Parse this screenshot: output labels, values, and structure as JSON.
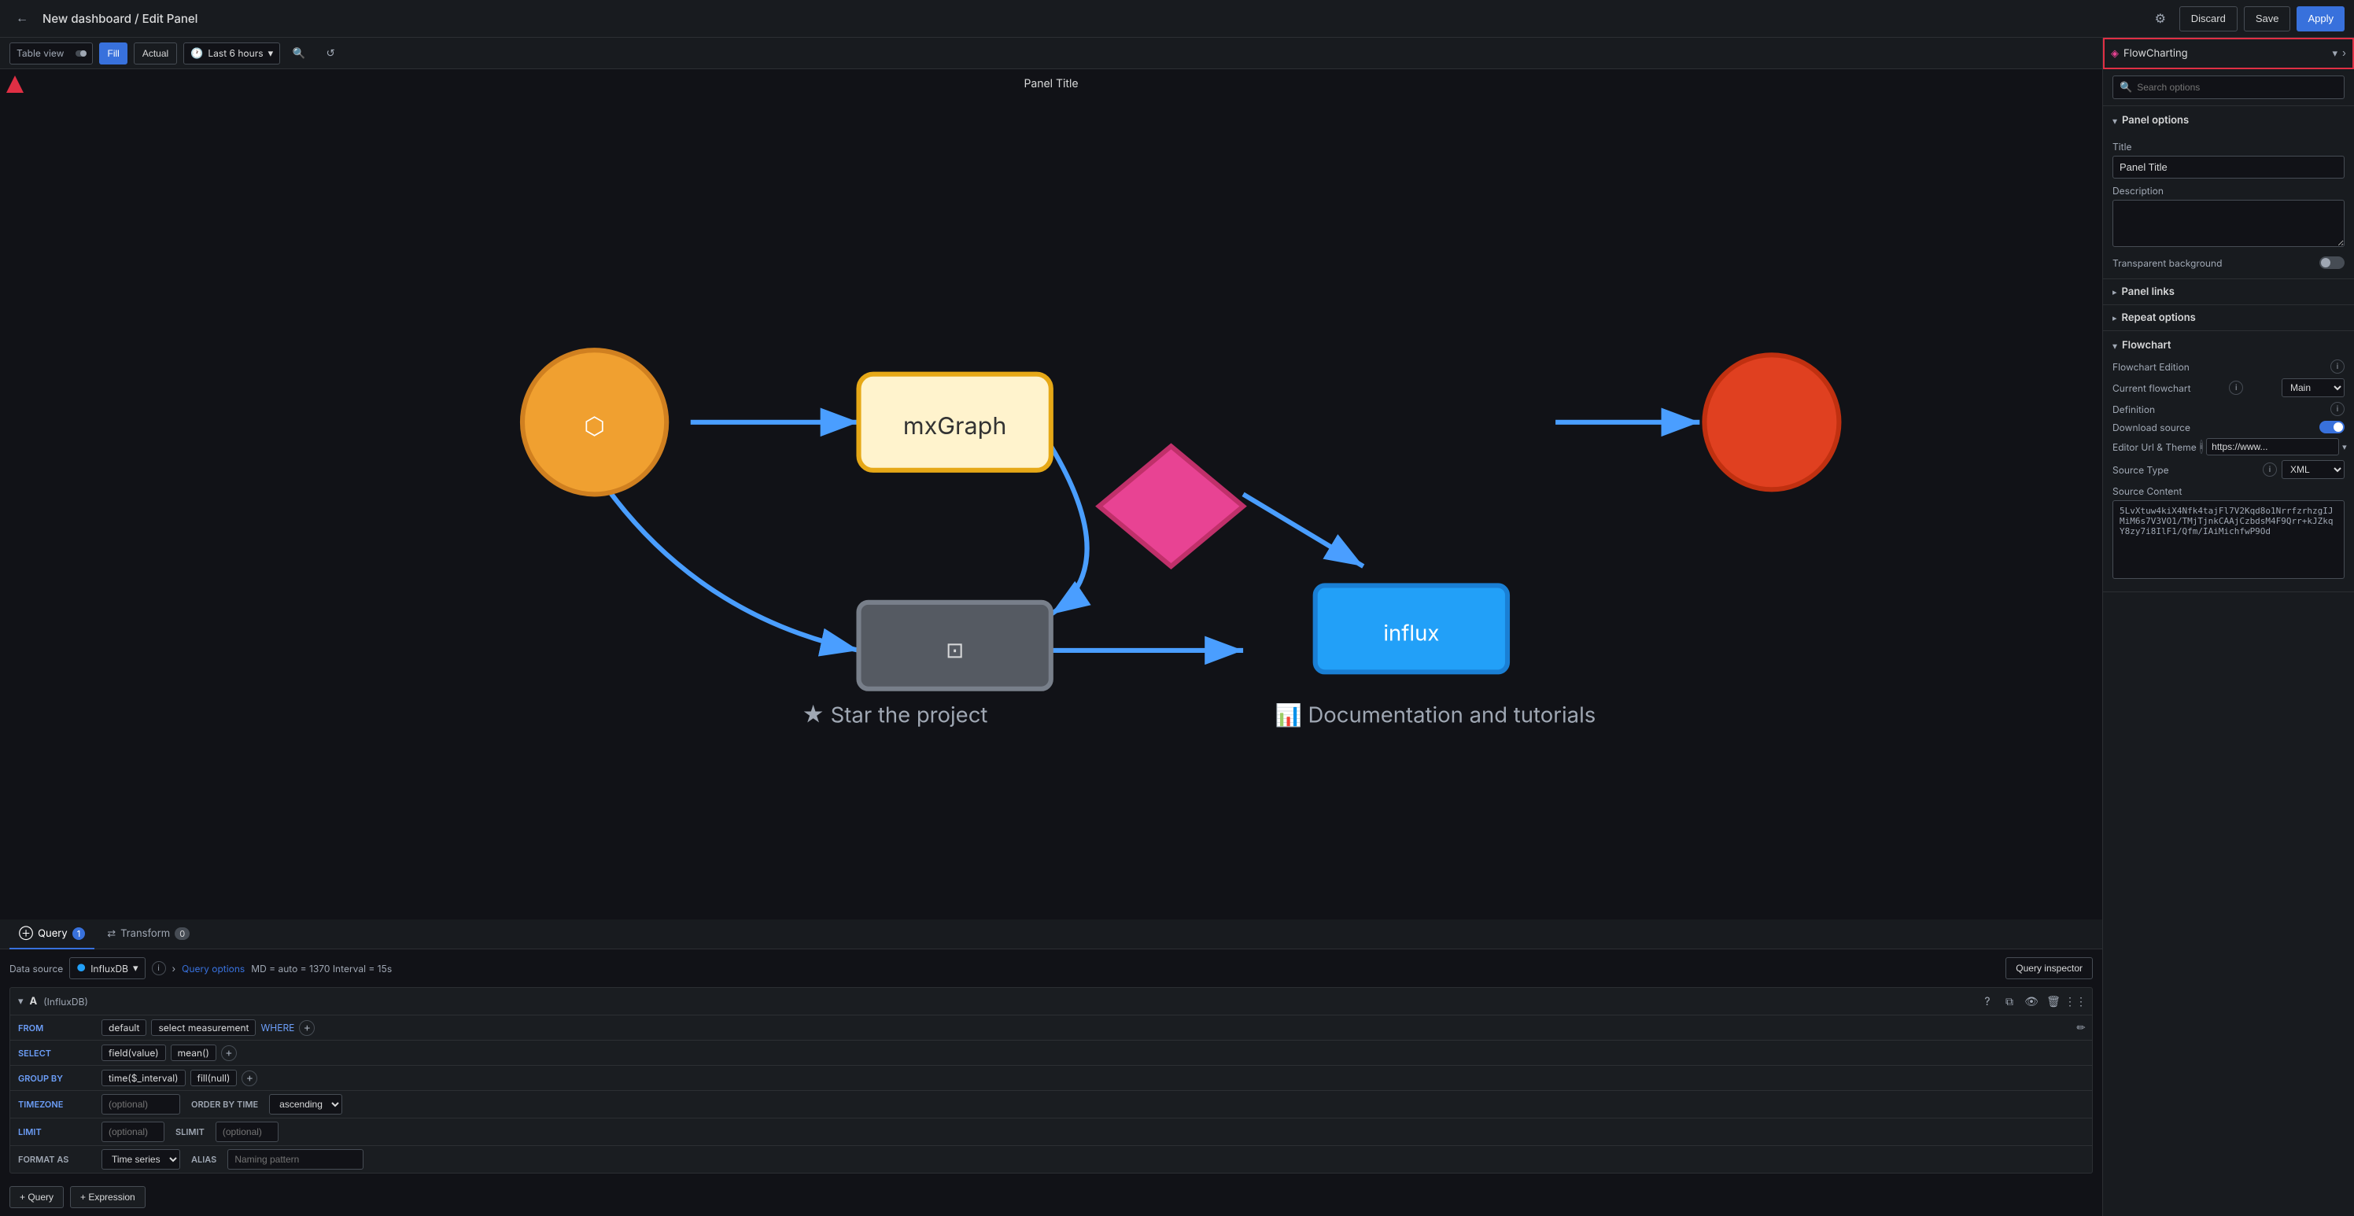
{
  "topbar": {
    "back_arrow": "←",
    "title": "New dashboard / Edit Panel",
    "gear_icon": "⚙",
    "discard_label": "Discard",
    "save_label": "Save",
    "apply_label": "Apply"
  },
  "panel_toolbar": {
    "table_view_label": "Table view",
    "fill_label": "Fill",
    "actual_label": "Actual",
    "time_label": "Last 6 hours",
    "panel_selector": "FlowCharting",
    "zoom_icon": "🔍",
    "refresh_icon": "↺"
  },
  "panel": {
    "title": "Panel Title",
    "alert_color": "#e02f44"
  },
  "query_tabs": [
    {
      "label": "Query",
      "badge": "1",
      "icon": "⊕"
    },
    {
      "label": "Transform",
      "badge": "0",
      "icon": "⇄"
    }
  ],
  "query_editor": {
    "datasource_label": "Data source",
    "datasource_value": "InfluxDB",
    "info_icon": "i",
    "query_options_label": "Query options",
    "meta": "MD = auto = 1370   Interval = 15s",
    "query_inspector_label": "Query inspector"
  },
  "query_block": {
    "letter": "A",
    "datasource": "(InfluxDB)",
    "rows": {
      "from_label": "FROM",
      "from_default": "default",
      "from_measurement": "select measurement",
      "where_label": "WHERE",
      "select_label": "SELECT",
      "select_field": "field(value)",
      "select_mean": "mean()",
      "group_by_label": "GROUP BY",
      "group_time": "time($_interval)",
      "group_fill": "fill(null)",
      "timezone_label": "TIMEZONE",
      "timezone_value": "(optional)",
      "order_label": "ORDER BY TIME",
      "order_value": "ascending",
      "limit_label": "LIMIT",
      "limit_value": "(optional)",
      "slimit_label": "SLIMIT",
      "slimit_value": "(optional)",
      "format_label": "FORMAT AS",
      "format_value": "Time series",
      "alias_label": "ALIAS",
      "alias_value": "Naming pattern"
    }
  },
  "add_row": {
    "query_label": "+ Query",
    "expression_label": "+ Expression"
  },
  "right_panel": {
    "search_placeholder": "Search options",
    "panel_options_section": "Panel options",
    "title_field_label": "Title",
    "title_value": "Panel Title",
    "description_label": "Description",
    "transparent_bg_label": "Transparent background",
    "panel_links_label": "Panel links",
    "repeat_options_label": "Repeat options",
    "flowchart_section": "Flowchart",
    "flowchart_edition_label": "Flowchart Edition",
    "current_flowchart_label": "Current flowchart",
    "current_flowchart_value": "Main",
    "definition_label": "Definition",
    "download_source_label": "Download source",
    "editor_url_label": "Editor Url & Theme",
    "editor_url_value": "https://www...",
    "source_type_label": "Source Type",
    "source_type_value": "XML",
    "source_content_label": "Source Content",
    "source_content_value": "5LvXtuw4kiX4Nfk4tajFl7V2Kqd8o1NrrfzrhzgIJMiM6s7V3VO1/TMjTjnkCAAjCzbdsM4F9Qrr+kJZkqY8zy7i8IlF1/Qfm/IAiMichfwP9Od"
  }
}
